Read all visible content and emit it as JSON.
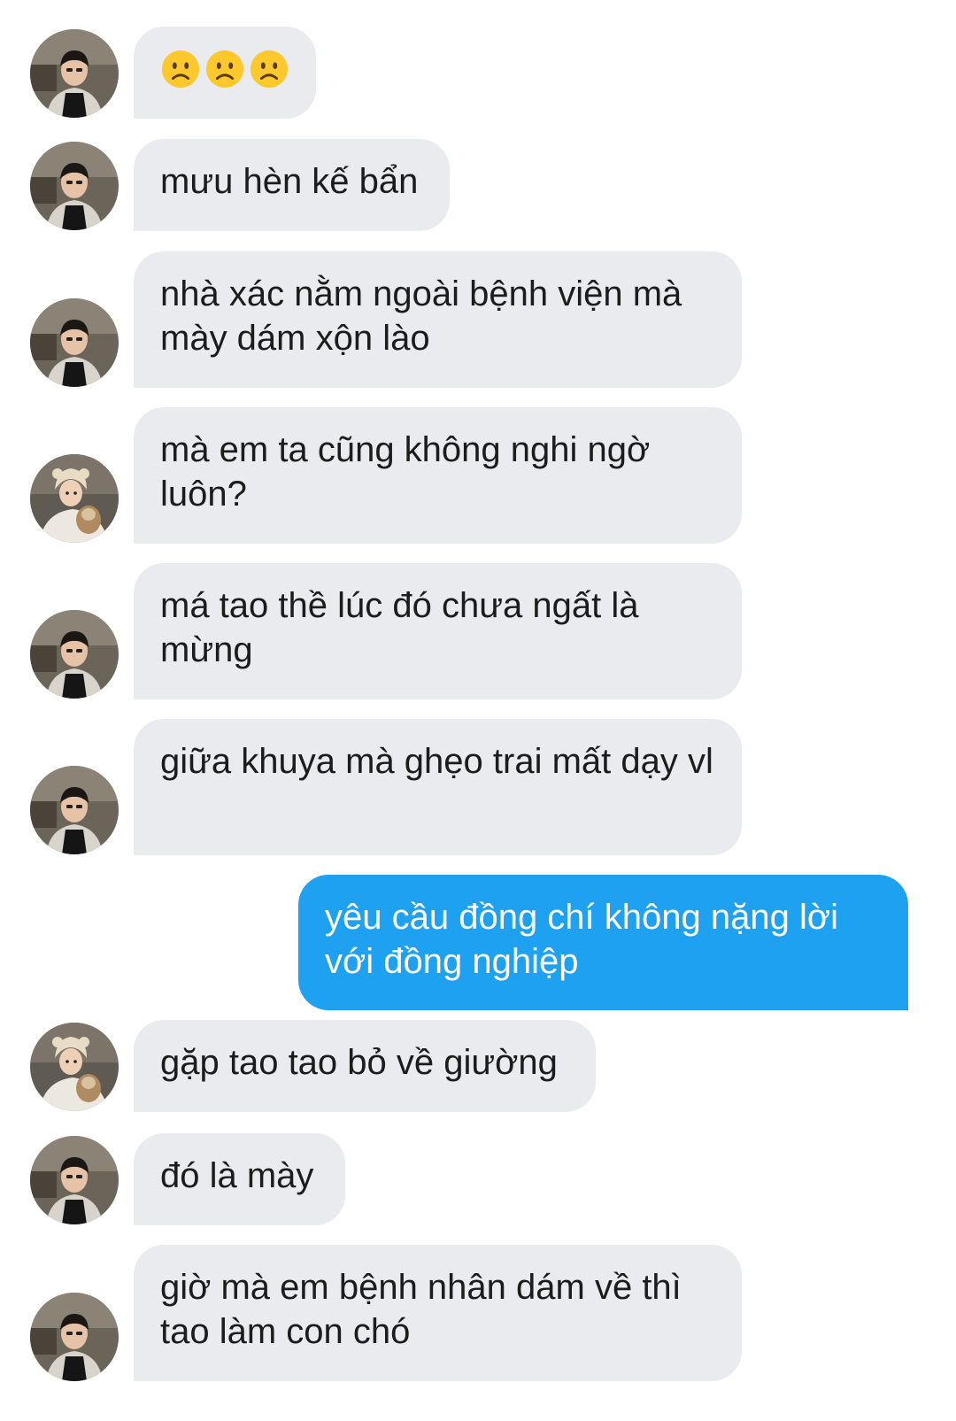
{
  "messages": [
    {
      "sender": "friend",
      "text": "",
      "emojis": [
        "frowning-face-emoji",
        "frowning-face-emoji",
        "frowning-face-emoji"
      ]
    },
    {
      "sender": "friend",
      "text": "mưu hèn kế bẩn"
    },
    {
      "sender": "friend",
      "text": "nhà xác nằm ngoài bệnh viện mà mày dám xộn lào"
    },
    {
      "sender": "friend2",
      "text": "mà em ta cũng không nghi ngờ luôn?"
    },
    {
      "sender": "friend",
      "text": "má tao thề lúc đó chưa ngất là mừng"
    },
    {
      "sender": "friend",
      "text": "giữa khuya mà ghẹo trai mất dạy vl"
    },
    {
      "sender": "me",
      "text": "yêu cầu đồng chí không nặng lời với đồng nghiệp"
    },
    {
      "sender": "friend2",
      "text": "gặp tao tao bỏ về giường"
    },
    {
      "sender": "friend",
      "text": "đó là mày"
    },
    {
      "sender": "friend",
      "text": "giờ mà em bệnh nhân dám về thì tao làm con chó"
    }
  ],
  "colors": {
    "incoming_bubble": "#e9ebee",
    "outgoing_bubble": "#1ea1f1",
    "incoming_text": "#1c1c1c",
    "outgoing_text": "#ffffff"
  }
}
